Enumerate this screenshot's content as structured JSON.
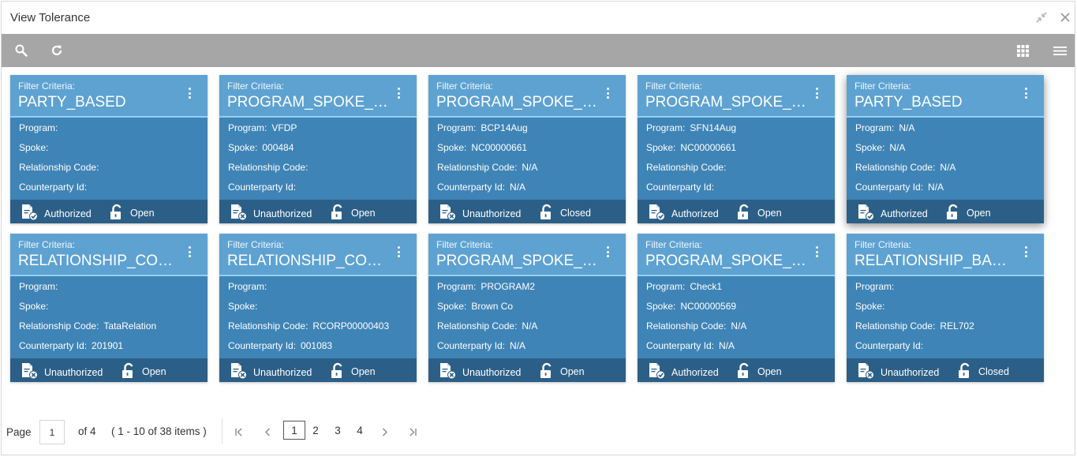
{
  "window": {
    "title": "View Tolerance"
  },
  "field_labels": {
    "filter_criteria": "Filter Criteria:",
    "program": "Program:",
    "spoke": "Spoke:",
    "relationship_code": "Relationship Code:",
    "counterparty_id": "Counterparty Id:"
  },
  "cards": [
    {
      "criteria": "PARTY_BASED",
      "program": "",
      "spoke": "",
      "relationship_code": "",
      "counterparty_id": "",
      "auth_status": "Authorized",
      "record_status": "Open"
    },
    {
      "criteria": "PROGRAM_SPOKE_B...",
      "program": "VFDP",
      "spoke": "000484",
      "relationship_code": "",
      "counterparty_id": "",
      "auth_status": "Unauthorized",
      "record_status": "Open"
    },
    {
      "criteria": "PROGRAM_SPOKE_B...",
      "program": "BCP14Aug",
      "spoke": "NC00000661",
      "relationship_code": "N/A",
      "counterparty_id": "N/A",
      "auth_status": "Unauthorized",
      "record_status": "Closed"
    },
    {
      "criteria": "PROGRAM_SPOKE_B...",
      "program": "SFN14Aug",
      "spoke": "NC00000661",
      "relationship_code": "",
      "counterparty_id": "",
      "auth_status": "Authorized",
      "record_status": "Open"
    },
    {
      "criteria": "PARTY_BASED",
      "program": "N/A",
      "spoke": "N/A",
      "relationship_code": "N/A",
      "counterparty_id": "N/A",
      "auth_status": "Authorized",
      "record_status": "Open"
    },
    {
      "criteria": "RELATIONSHIP_COU...",
      "program": "",
      "spoke": "",
      "relationship_code": "TataRelation",
      "counterparty_id": "201901",
      "auth_status": "Unauthorized",
      "record_status": "Open"
    },
    {
      "criteria": "RELATIONSHIP_COU...",
      "program": "",
      "spoke": "",
      "relationship_code": "RCORP00000403",
      "counterparty_id": "001083",
      "auth_status": "Unauthorized",
      "record_status": "Open"
    },
    {
      "criteria": "PROGRAM_SPOKE_B...",
      "program": "PROGRAM2",
      "spoke": "Brown Co",
      "relationship_code": "N/A",
      "counterparty_id": "N/A",
      "auth_status": "Unauthorized",
      "record_status": "Open"
    },
    {
      "criteria": "PROGRAM_SPOKE_B...",
      "program": "Check1",
      "spoke": "NC00000569",
      "relationship_code": "N/A",
      "counterparty_id": "N/A",
      "auth_status": "Authorized",
      "record_status": "Open"
    },
    {
      "criteria": "RELATIONSHIP_BASED",
      "program": "",
      "spoke": "",
      "relationship_code": "REL702",
      "counterparty_id": "",
      "auth_status": "Unauthorized",
      "record_status": "Closed"
    }
  ],
  "pagination": {
    "page_label": "Page",
    "current_page": "1",
    "of_total": "of 4",
    "range_text": "( 1 - 10 of 38 items )",
    "pages": [
      "1",
      "2",
      "3",
      "4"
    ]
  },
  "icons": {
    "search": "search-icon",
    "refresh": "refresh-icon",
    "grid_view": "grid-view-icon",
    "list_view": "list-view-icon",
    "minimize": "minimize-icon",
    "close": "close-icon",
    "more": "kebab-menu-icon"
  },
  "colors": {
    "card_body": "#3f84b6",
    "card_head": "#5ea2d2",
    "card_foot": "#2c5f87",
    "toolbar": "#a6a6a6"
  }
}
